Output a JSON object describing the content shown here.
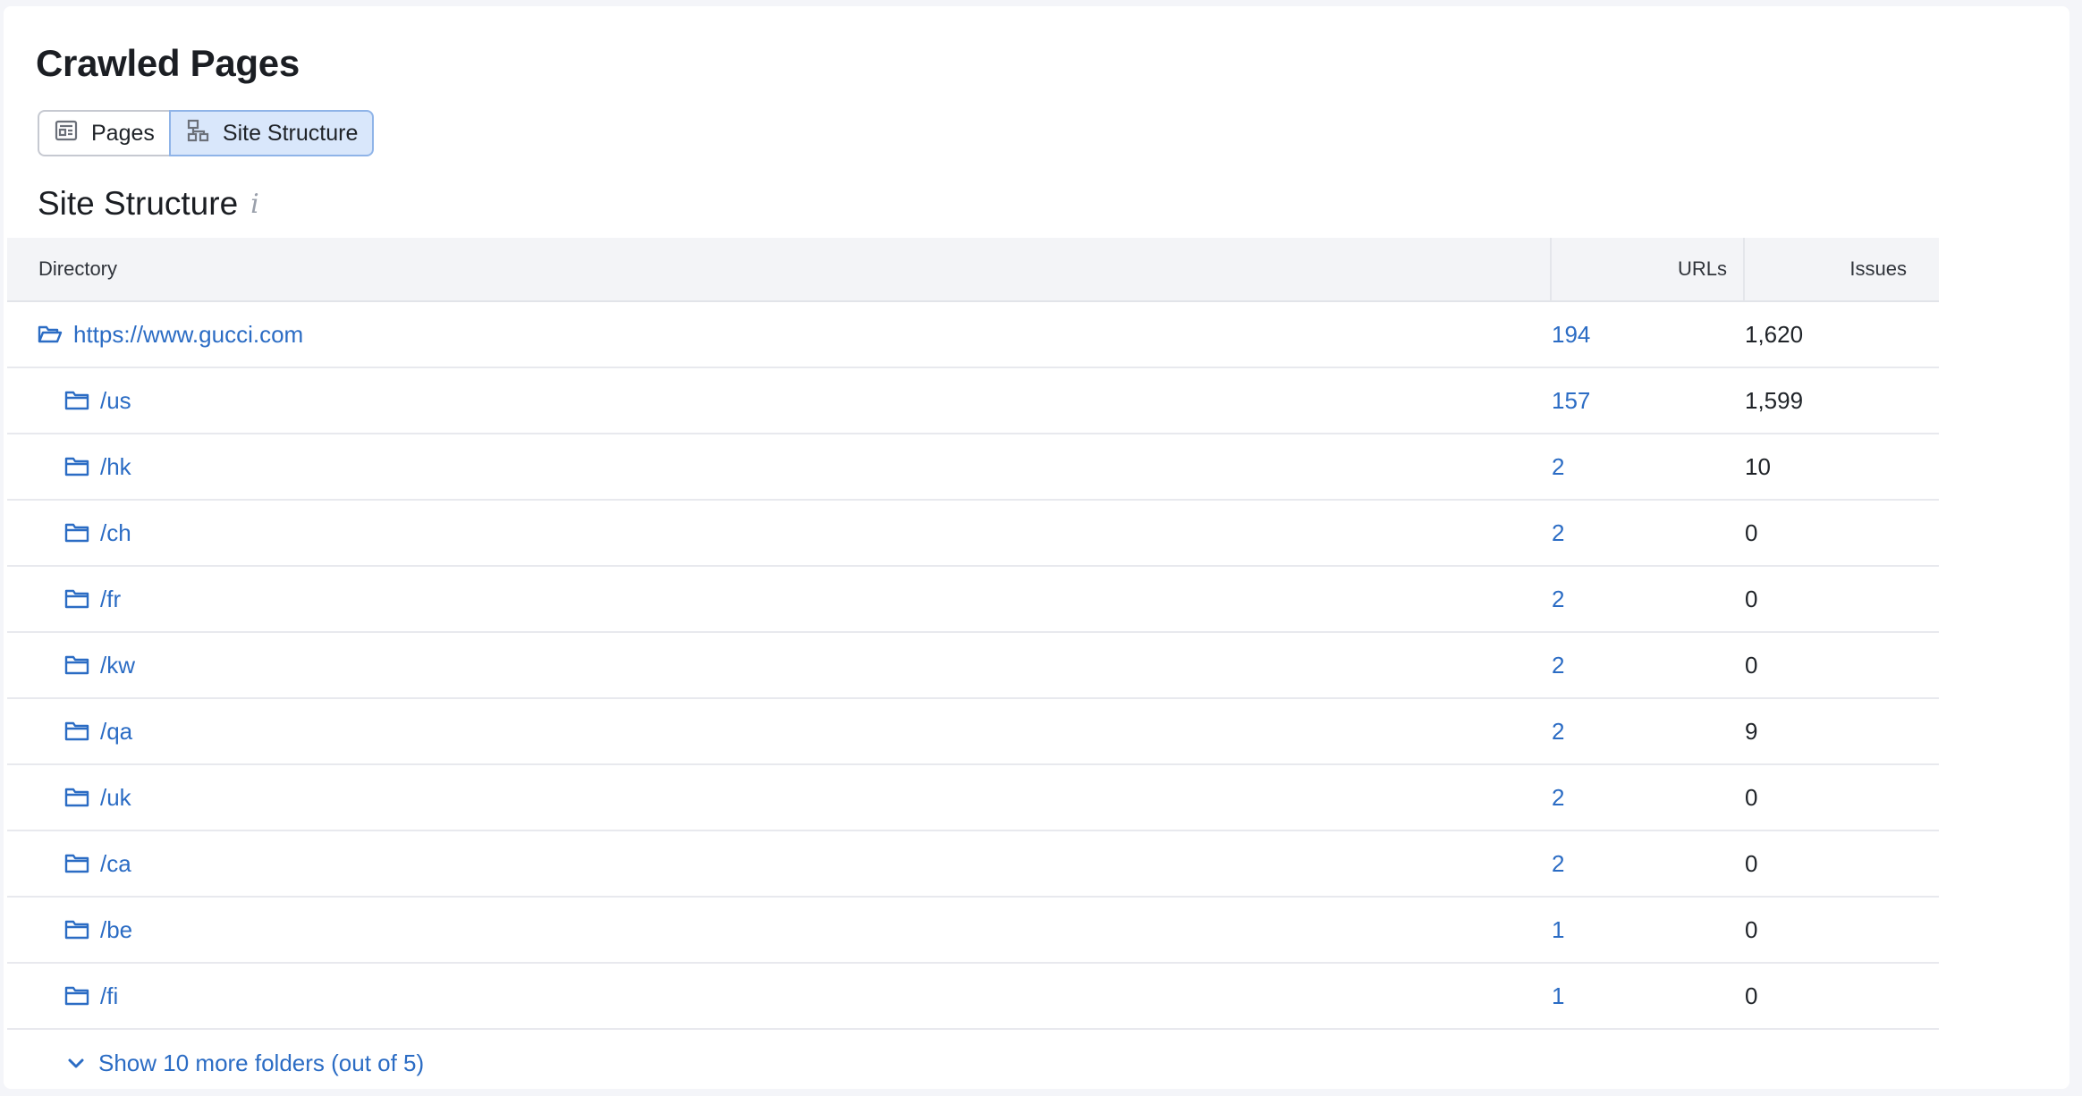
{
  "page": {
    "title": "Crawled Pages"
  },
  "view_toggle": {
    "pages_label": "Pages",
    "site_structure_label": "Site Structure"
  },
  "section": {
    "title": "Site Structure",
    "info_glyph": "i"
  },
  "table": {
    "headers": {
      "directory": "Directory",
      "urls": "URLs",
      "issues": "Issues"
    },
    "rows": [
      {
        "directory": "https://www.gucci.com",
        "urls": "194",
        "issues": "1,620"
      },
      {
        "directory": "/us",
        "urls": "157",
        "issues": "1,599"
      },
      {
        "directory": "/hk",
        "urls": "2",
        "issues": "10"
      },
      {
        "directory": "/ch",
        "urls": "2",
        "issues": "0"
      },
      {
        "directory": "/fr",
        "urls": "2",
        "issues": "0"
      },
      {
        "directory": "/kw",
        "urls": "2",
        "issues": "0"
      },
      {
        "directory": "/qa",
        "urls": "2",
        "issues": "9"
      },
      {
        "directory": "/uk",
        "urls": "2",
        "issues": "0"
      },
      {
        "directory": "/ca",
        "urls": "2",
        "issues": "0"
      },
      {
        "directory": "/be",
        "urls": "1",
        "issues": "0"
      },
      {
        "directory": "/fi",
        "urls": "1",
        "issues": "0"
      }
    ],
    "show_more_label": "Show 10 more folders (out of 5)"
  },
  "colors": {
    "link": "#2b6cc4",
    "active_toggle_bg": "#d9e7fb",
    "header_bg": "#f3f4f7"
  }
}
